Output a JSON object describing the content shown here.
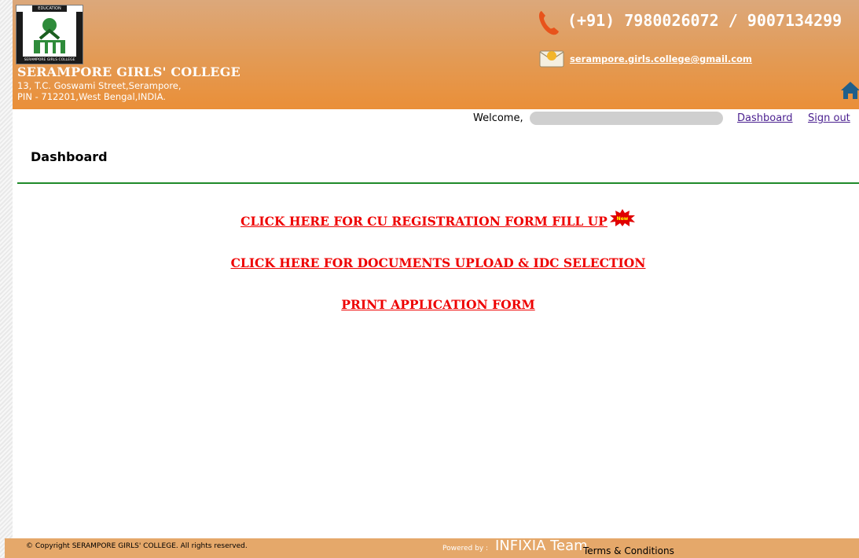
{
  "header": {
    "logo": {
      "top_text": "EDUCATION",
      "left_text": "ENLIGHTENMENT",
      "right_text": "EMPOWERMENT",
      "bottom_text": "SERAMPORE GIRLS COLLEGE"
    },
    "college_name": "SERAMPORE GIRLS' COLLEGE",
    "address_line1": "13, T.C. Goswami Street,Serampore,",
    "address_line2": "PIN - 712201,West Bengal,INDIA.",
    "phone": "(+91) 7980026072 / 9007134299",
    "email": "serampore.girls.college@gmail.com",
    "icons": {
      "phone": "phone-icon",
      "mail": "mail-icon",
      "home": "home-icon"
    }
  },
  "topbar": {
    "welcome": "Welcome,",
    "dashboard_link": "Dashboard",
    "signout_link": "Sign out"
  },
  "main": {
    "title": "Dashboard",
    "links": [
      "CLICK HERE FOR CU REGISTRATION FORM FILL UP",
      "CLICK HERE FOR DOCUMENTS UPLOAD & IDC SELECTION",
      "PRINT APPLICATION FORM"
    ],
    "new_badge": "New"
  },
  "footer": {
    "copyright": "© Copyright SERAMPORE GIRLS' COLLEGE. All rights reserved.",
    "powered_by": "Powered by :",
    "team": "INFIXIA Team",
    "terms": "Terms & Conditions"
  },
  "colors": {
    "header_top": "#dca87b",
    "header_bottom": "#ea8f38",
    "link_red": "#ee0000",
    "rule_green": "#1f8a2a",
    "visited_link": "#4a1f8f",
    "footer_bg": "#e5a86a"
  }
}
